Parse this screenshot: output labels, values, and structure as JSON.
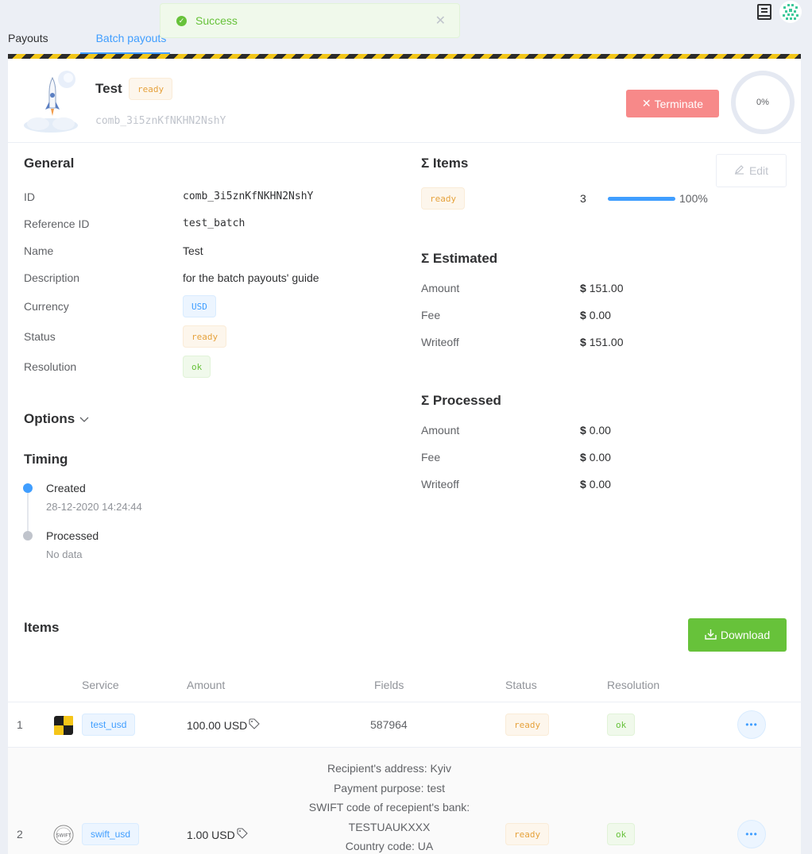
{
  "tabs": [
    "Payouts",
    "Batch payouts"
  ],
  "toast": {
    "message": "Success"
  },
  "header": {
    "title": "Test",
    "status": "ready",
    "batch_id": "comb_3i5znKfNKHN2NshY",
    "terminate_label": "Terminate",
    "progress": "0%"
  },
  "general": {
    "heading": "General",
    "rows": [
      {
        "label": "ID",
        "value": "comb_3i5znKfNKHN2NshY"
      },
      {
        "label": "Reference ID",
        "value": "test_batch"
      },
      {
        "label": "Name",
        "value": "Test"
      },
      {
        "label": "Description",
        "value": "for the batch payouts' guide"
      },
      {
        "label": "Currency",
        "value": "USD"
      },
      {
        "label": "Status",
        "value": "ready"
      },
      {
        "label": "Resolution",
        "value": "ok"
      }
    ],
    "options_label": "Options"
  },
  "timing": {
    "heading": "Timing",
    "created_label": "Created",
    "created_value": "28-12-2020 14:24:44",
    "processed_label": "Processed",
    "processed_value": "No data"
  },
  "items_summary": {
    "heading": "Σ Items",
    "status": "ready",
    "count": "3",
    "percent": "100%",
    "progress_fraction": 1.0,
    "edit_label": "Edit"
  },
  "estimated": {
    "heading": "Σ Estimated",
    "rows": [
      {
        "label": "Amount",
        "value": "151.00"
      },
      {
        "label": "Fee",
        "value": "0.00"
      },
      {
        "label": "Writeoff",
        "value": "151.00"
      }
    ]
  },
  "processed": {
    "heading": "Σ Processed",
    "rows": [
      {
        "label": "Amount",
        "value": "0.00"
      },
      {
        "label": "Fee",
        "value": "0.00"
      },
      {
        "label": "Writeoff",
        "value": "0.00"
      }
    ]
  },
  "currency_symbol": "$",
  "items": {
    "heading": "Items",
    "download_label": "Download",
    "columns": [
      "Service",
      "Amount",
      "Fields",
      "Status",
      "Resolution"
    ],
    "rows": [
      {
        "index": "1",
        "service": "test_usd",
        "amount": "100.00 USD",
        "fields": "587964",
        "status": "ready",
        "resolution": "ok"
      },
      {
        "index": "2",
        "service": "swift_usd",
        "amount": "1.00 USD",
        "fields": [
          "Recipient's address: Kyiv",
          "Payment purpose: test",
          "SWIFT code of recepient's bank:",
          "TESTUAUKXXX",
          "Country code: UA"
        ],
        "status": "ready",
        "resolution": "ok"
      }
    ]
  },
  "colors": {
    "primary": "#409eff",
    "success": "#67c23a",
    "danger": "#f78989",
    "warning": "#e6a23c"
  }
}
